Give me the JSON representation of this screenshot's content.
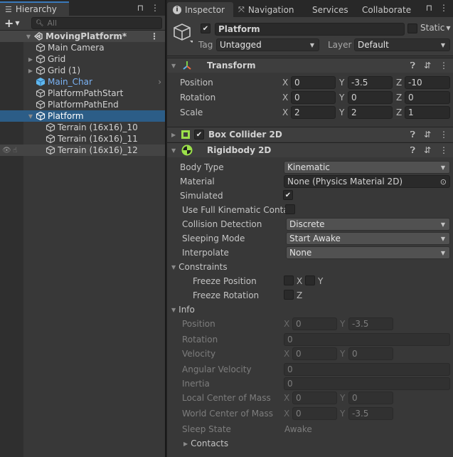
{
  "hierarchy": {
    "tab_label": "Hierarchy",
    "search_placeholder": "All",
    "scene": "MovingPlatform*",
    "items": [
      {
        "label": "Main Camera",
        "expand": "none",
        "prefab": false
      },
      {
        "label": "Grid",
        "expand": "collapsed",
        "prefab": false
      },
      {
        "label": "Grid (1)",
        "expand": "collapsed",
        "prefab": false
      },
      {
        "label": "Main_Char",
        "expand": "none",
        "prefab": true
      },
      {
        "label": "PlatformPathStart",
        "expand": "none",
        "prefab": false
      },
      {
        "label": "PlatformPathEnd",
        "expand": "none",
        "prefab": false
      },
      {
        "label": "Platform",
        "expand": "expanded",
        "prefab": false,
        "selected": true
      },
      {
        "label": "Terrain (16x16)_10",
        "expand": "none",
        "prefab": false
      },
      {
        "label": "Terrain (16x16)_11",
        "expand": "none",
        "prefab": false
      },
      {
        "label": "Terrain (16x16)_12",
        "expand": "none",
        "prefab": false,
        "hovered": true
      }
    ]
  },
  "inspector": {
    "tabs": [
      "Inspector",
      "Navigation",
      "Services",
      "Collaborate"
    ],
    "gameobject": {
      "active": true,
      "name": "Platform",
      "static_label": "Static",
      "static": false,
      "tag_label": "Tag",
      "tag": "Untagged",
      "layer_label": "Layer",
      "layer": "Default"
    },
    "transform": {
      "title": "Transform",
      "rows": [
        {
          "label": "Position",
          "x": "0",
          "y": "-3.5",
          "z": "-10"
        },
        {
          "label": "Rotation",
          "x": "0",
          "y": "0",
          "z": "0"
        },
        {
          "label": "Scale",
          "x": "2",
          "y": "2",
          "z": "1"
        }
      ]
    },
    "box_collider": {
      "title": "Box Collider 2D",
      "enabled": true
    },
    "rigidbody": {
      "title": "Rigidbody 2D",
      "body_type_label": "Body Type",
      "body_type": "Kinematic",
      "material_label": "Material",
      "material": "None (Physics Material 2D)",
      "simulated_label": "Simulated",
      "simulated": true,
      "full_kinematic_label": "Use Full Kinematic Conta",
      "full_kinematic": false,
      "collision_label": "Collision Detection",
      "collision": "Discrete",
      "sleeping_label": "Sleeping Mode",
      "sleeping": "Start Awake",
      "interpolate_label": "Interpolate",
      "interpolate": "None",
      "constraints_label": "Constraints",
      "freeze_pos_label": "Freeze Position",
      "freeze_rot_label": "Freeze Rotation",
      "info_label": "Info",
      "info": {
        "position_label": "Position",
        "position_x": "0",
        "position_y": "-3.5",
        "rotation_label": "Rotation",
        "rotation": "0",
        "velocity_label": "Velocity",
        "velocity_x": "0",
        "velocity_y": "0",
        "angular_label": "Angular Velocity",
        "angular": "0",
        "inertia_label": "Inertia",
        "inertia": "0",
        "local_com_label": "Local Center of Mass",
        "local_com_x": "0",
        "local_com_y": "0",
        "world_com_label": "World Center of Mass",
        "world_com_x": "0",
        "world_com_y": "-3.5",
        "sleep_state_label": "Sleep State",
        "sleep_state": "Awake",
        "contacts_label": "Contacts"
      }
    }
  },
  "axis_labels": {
    "x": "X",
    "y": "Y",
    "z": "Z"
  }
}
